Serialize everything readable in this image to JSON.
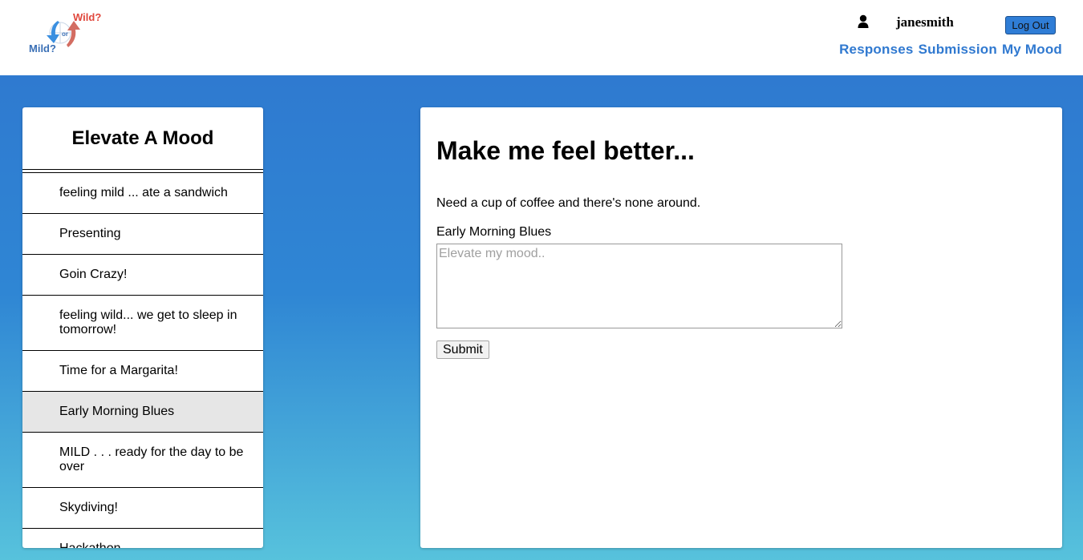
{
  "header": {
    "logo": {
      "top_word": "Wild?",
      "middle_word": "or",
      "bottom_word": "Mild?"
    },
    "username": "janesmith",
    "logout_label": "Log Out",
    "nav": [
      "Responses",
      "Submission",
      "My Mood"
    ]
  },
  "sidebar": {
    "title": "Elevate A Mood",
    "items": [
      "feeling mild ... ate a sandwich",
      "Presenting",
      "Goin Crazy!",
      "feeling wild... we get to sleep in tomorrow!",
      "Time for a Margarita!",
      "Early Morning Blues",
      "MILD . . . ready for the day to be over",
      "Skydiving!",
      "Hackathon"
    ],
    "active_index": 5
  },
  "panel": {
    "title": "Make me feel better...",
    "description": "Need a cup of coffee and there's none around.",
    "mood_label": "Early Morning Blues",
    "textarea_placeholder": "Elevate my mood..",
    "submit_label": "Submit"
  },
  "colors": {
    "accent": "#3079d0",
    "gradient_top": "#2f7ad0",
    "gradient_bottom": "#57c2dc",
    "logout_button": "#2f7dd6",
    "logo_red": "#e0473c",
    "logo_blue": "#3a6fb5",
    "active_item": "#e6e6e6"
  },
  "icons": {
    "user": "user-icon",
    "logo": "wild-or-mild-logo"
  }
}
